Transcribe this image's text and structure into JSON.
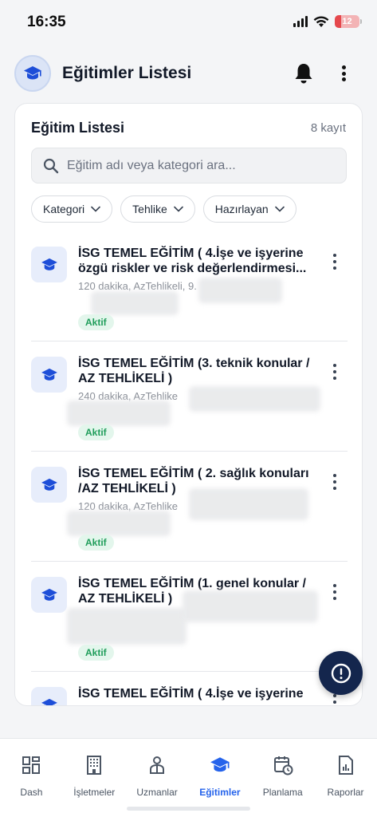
{
  "status_bar": {
    "time": "16:35",
    "battery": "12"
  },
  "header": {
    "title": "Eğitimler Listesi",
    "avatar_icon": "graduation-cap-icon"
  },
  "card": {
    "title": "Eğitim Listesi",
    "count": "8 kayıt",
    "search_placeholder": "Eğitim adı veya kategori ara...",
    "filters": [
      "Kategori",
      "Tehlike",
      "Hazırlayan"
    ]
  },
  "items": [
    {
      "title": "İSG TEMEL EĞİTİM ( 4.İşe ve işyerine özgü riskler ve risk değerlendirmesi...",
      "meta": "120 dakika, AzTehlikeli, 9.",
      "status": "Aktif"
    },
    {
      "title": "İSG TEMEL EĞİTİM (3. teknik konular / AZ TEHLİKELİ )",
      "meta": "240 dakika, AzTehlike",
      "status": "Aktif"
    },
    {
      "title": "İSG TEMEL EĞİTİM ( 2. sağlık konuları /AZ TEHLİKELİ )",
      "meta": "120 dakika, AzTehlike",
      "status": "Aktif"
    },
    {
      "title": "İSG TEMEL EĞİTİM (1. genel konular / AZ TEHLİKELİ )",
      "meta": "",
      "status": "Aktif"
    },
    {
      "title": "İSG TEMEL EĞİTİM ( 4.İşe ve işyerine",
      "meta": "",
      "status": ""
    }
  ],
  "nav": [
    {
      "label": "Dash",
      "icon": "dashboard-icon"
    },
    {
      "label": "İşletmeler",
      "icon": "building-icon"
    },
    {
      "label": "Uzmanlar",
      "icon": "experts-icon"
    },
    {
      "label": "Eğitimler",
      "icon": "graduation-cap-icon"
    },
    {
      "label": "Planlama",
      "icon": "calendar-clock-icon"
    },
    {
      "label": "Raporlar",
      "icon": "report-icon"
    }
  ],
  "colors": {
    "accent": "#2563eb",
    "fab": "#14264d",
    "status_active": "#1f9d5a"
  }
}
